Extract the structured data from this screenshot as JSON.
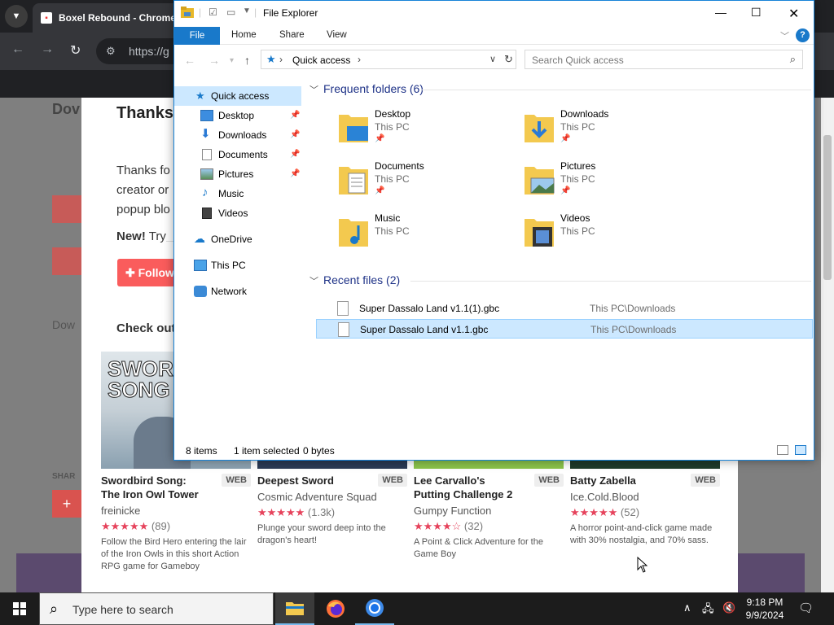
{
  "browser": {
    "tab_title": "Boxel Rebound - Chrome",
    "url": "https://g",
    "page_ghost_title": "Dov",
    "page_ghost_dow": "Dow",
    "page_ghost_share": "SHAR"
  },
  "page": {
    "thanks_title": "Thanks",
    "thanks_text": "Thanks fo creator or popup blo",
    "new_label": "New!",
    "new_text": " Try",
    "follow_label": "Follow",
    "check_out": "Check out",
    "games": [
      {
        "title": "Swordbird Song: The Iron Owl Tower",
        "badge": "WEB",
        "author": "freinicke",
        "stars": "★★★★★",
        "count": "(89)",
        "desc": "Follow the Bird Hero entering the lair of the Iron Owls in this short Action RPG game for Gameboy",
        "thumb_text": "SWORD SONG"
      },
      {
        "title": "Deepest Sword",
        "badge": "WEB",
        "author": "Cosmic Adventure Squad",
        "stars": "★★★★★",
        "count": "(1.3k)",
        "desc": "Plunge your sword deep into the dragon's heart!"
      },
      {
        "title": "Lee Carvallo's Putting Challenge 2",
        "badge": "WEB",
        "author": "Gumpy Function",
        "stars": "★★★★☆",
        "count": "(32)",
        "desc": "A Point & Click Adventure for the Game Boy"
      },
      {
        "title": "Batty Zabella",
        "badge": "WEB",
        "author": "Ice.Cold.Blood",
        "stars": "★★★★★",
        "count": "(52)",
        "desc": "A horror point-and-click game made with 30% nostalgia, and 70% sass."
      }
    ]
  },
  "explorer": {
    "title": "File Explorer",
    "ribbon_tabs": [
      "File",
      "Home",
      "Share",
      "View"
    ],
    "address": "Quick access",
    "search_placeholder": "Search Quick access",
    "nav": [
      {
        "label": "Quick access"
      },
      {
        "label": "Desktop"
      },
      {
        "label": "Downloads"
      },
      {
        "label": "Documents"
      },
      {
        "label": "Pictures"
      },
      {
        "label": "Music"
      },
      {
        "label": "Videos"
      },
      {
        "label": "OneDrive"
      },
      {
        "label": "This PC"
      },
      {
        "label": "Network"
      }
    ],
    "frequent_header": "Frequent folders (6)",
    "folders": [
      {
        "name": "Desktop",
        "loc": "This PC"
      },
      {
        "name": "Downloads",
        "loc": "This PC"
      },
      {
        "name": "Documents",
        "loc": "This PC"
      },
      {
        "name": "Pictures",
        "loc": "This PC"
      },
      {
        "name": "Music",
        "loc": "This PC"
      },
      {
        "name": "Videos",
        "loc": "This PC"
      }
    ],
    "recent_header": "Recent files (2)",
    "recent": [
      {
        "name": "Super Dassalo Land v1.1(1).gbc",
        "loc": "This PC\\Downloads"
      },
      {
        "name": "Super Dassalo Land v1.1.gbc",
        "loc": "This PC\\Downloads"
      }
    ],
    "status_items": "8 items",
    "status_selected": "1 item selected",
    "status_size": "0 bytes"
  },
  "taskbar": {
    "search_placeholder": "Type here to search",
    "time": "9:18 PM",
    "date": "9/9/2024"
  },
  "colors": {
    "accent": "#1979ca",
    "selection": "#cce8ff",
    "itch_red": "#fa5c5c"
  }
}
